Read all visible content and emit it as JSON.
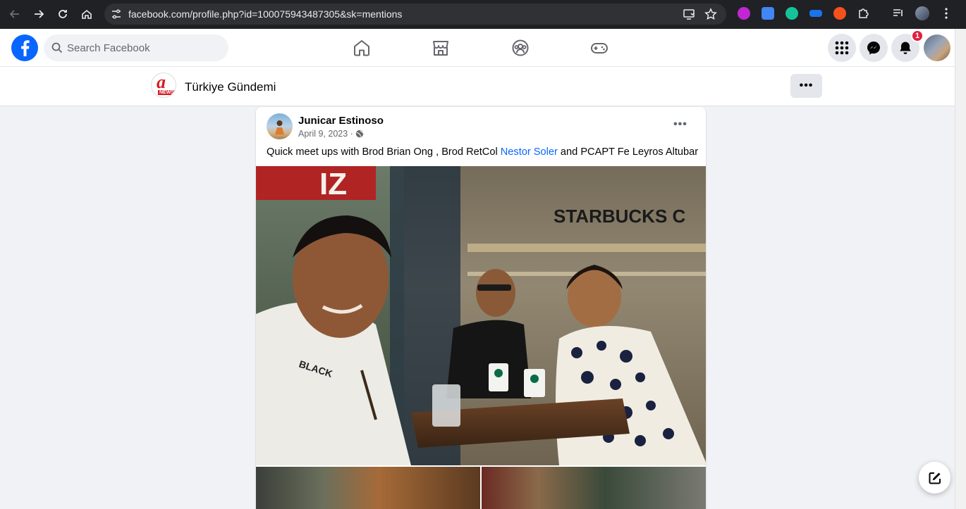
{
  "browser": {
    "url": "facebook.com/profile.php?id=100075943487305&sk=mentions"
  },
  "fb_nav": {
    "search_placeholder": "Search Facebook",
    "notification_count": "1"
  },
  "page_header": {
    "title": "Türkiye Gündemi",
    "logo_text": "a",
    "logo_subtext": "NEWS",
    "more_label": "•••"
  },
  "post": {
    "author": "Junicar Estinoso",
    "date": "April 9, 2023 ·",
    "more_label": "•••",
    "text_before": "Quick meet ups with Brod Brian Ong , Brod RetCol ",
    "mention": "Nestor Soler",
    "text_after": " and PCAPT Fe Leyros Altubar",
    "photo_signage": "STARBUCKS C",
    "shirt_text": "BLACK",
    "sign_text": "IZ"
  },
  "colors": {
    "fb_blue": "#0866ff",
    "badge_red": "#e41e3f",
    "chrome_dark": "#202124"
  }
}
